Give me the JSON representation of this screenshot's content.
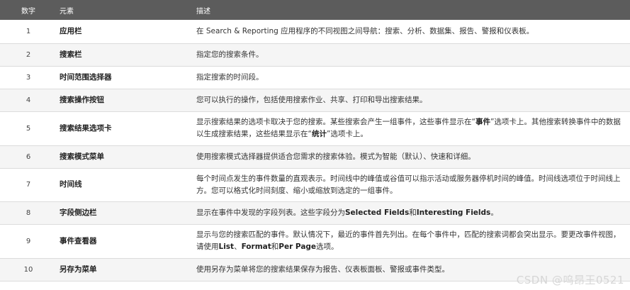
{
  "header": {
    "col_num": "数字",
    "col_element": "元素",
    "col_desc": "描述"
  },
  "rows": [
    {
      "num": "1",
      "element": "应用栏",
      "desc": "在 Search & Reporting 应用程序的不同视图之间导航：搜索、分析、数据集、报告、警报和仪表板。"
    },
    {
      "num": "2",
      "element": "搜索栏",
      "desc": "指定您的搜索条件。"
    },
    {
      "num": "3",
      "element": "时间范围选择器",
      "desc": "指定搜索的时间段。"
    },
    {
      "num": "4",
      "element": "搜索操作按钮",
      "desc": "您可以执行的操作，包括使用搜索作业、共享、打印和导出搜索结果。"
    },
    {
      "num": "5",
      "element": "搜索结果选项卡",
      "desc_parts": [
        "显示搜索结果的选项卡取决于您的搜索。某些搜索会产生一组事件，这些事件显示在“",
        "事件",
        "”选项卡上。其他搜索转换事件中的数据以生成搜索结果，这些结果显示在“",
        "统计",
        "”选项卡上。"
      ]
    },
    {
      "num": "6",
      "element": "搜索模式菜单",
      "desc": "使用搜索模式选择器提供适合您需求的搜索体验。模式为智能（默认）、快速和详细。"
    },
    {
      "num": "7",
      "element": "时间线",
      "desc": "每个时间点发生的事件数量的直观表示。时间线中的峰值或谷值可以指示活动或服务器停机时间的峰值。时间线选项位于时间线上方。您可以格式化时间刻度、缩小或缩放到选定的一组事件。"
    },
    {
      "num": "8",
      "element": "字段侧边栏",
      "desc_parts": [
        "显示在事件中发现的字段列表。这些字段分为",
        "Selected Fields",
        "和",
        "Interesting Fields",
        "。"
      ]
    },
    {
      "num": "9",
      "element": "事件查看器",
      "desc_parts": [
        "显示与您的搜索匹配的事件。默认情况下，最近的事件首先列出。在每个事件中，匹配的搜索词都会突出显示。要更改事件视图，请使用",
        "List",
        "、",
        "Format",
        "和",
        "Per Page",
        "选项。"
      ]
    },
    {
      "num": "10",
      "element": "另存为菜单",
      "desc": "使用另存为菜单将您的搜索结果保存为报告、仪表板面板、警报或事件类型。"
    }
  ],
  "watermark": "CSDN @呜昂王0521"
}
